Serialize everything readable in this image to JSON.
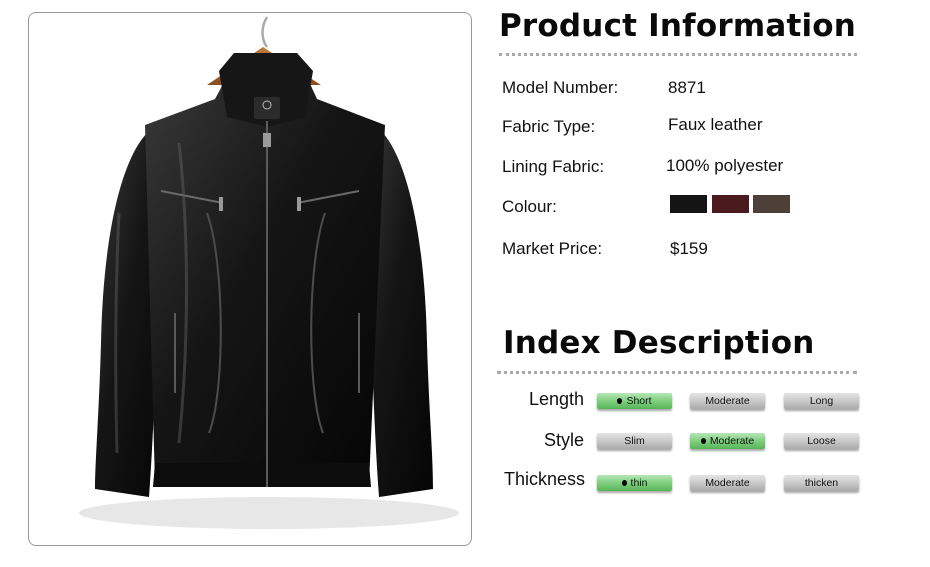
{
  "product_info": {
    "title": "Product Information",
    "rows": [
      {
        "label": "Model Number:",
        "value": "8871"
      },
      {
        "label": "Fabric Type:",
        "value": "Faux leather"
      },
      {
        "label": "Lining Fabric:",
        "value": "100% polyester"
      },
      {
        "label": "Colour:",
        "swatches": [
          "#141414",
          "#4a1a1e",
          "#4d4038"
        ]
      },
      {
        "label": "Market Price:",
        "value": "$159"
      }
    ]
  },
  "index_description": {
    "title": "Index Description",
    "rows": [
      {
        "label": "Length",
        "options": [
          "Short",
          "Moderate",
          "Long"
        ],
        "selected": "Short"
      },
      {
        "label": "Style",
        "options": [
          "Slim",
          "Moderate",
          "Loose"
        ],
        "selected": "Moderate"
      },
      {
        "label": "Thickness",
        "options": [
          "thin",
          "Moderate",
          "thicken"
        ],
        "selected": "thin"
      }
    ]
  },
  "colors": {
    "selected_pill": "#7fcf7f",
    "unselected_pill": "#c9c9c9",
    "dotted_rule": "#a9a9a9"
  },
  "image": {
    "subject": "black faux leather jacket on wooden hanger",
    "icons": [
      "hanger-icon",
      "jacket-image"
    ]
  }
}
